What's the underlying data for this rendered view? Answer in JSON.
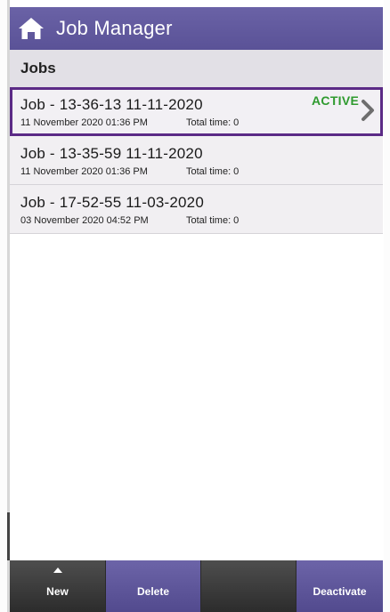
{
  "header": {
    "title": "Job Manager",
    "home_icon": "home-icon",
    "color": "#5f579d"
  },
  "section": {
    "title": "Jobs"
  },
  "jobs": [
    {
      "name": "Job - 13-36-13 11-11-2020",
      "date": "11 November 2020 01:36 PM",
      "total": "Total time: 0",
      "status": "ACTIVE",
      "selected": true
    },
    {
      "name": "Job - 13-35-59 11-11-2020",
      "date": "11 November 2020 01:36 PM",
      "total": "Total time: 0",
      "status": "",
      "selected": false
    },
    {
      "name": "Job - 17-52-55 11-03-2020",
      "date": "03 November 2020 04:52 PM",
      "total": "Total time: 0",
      "status": "",
      "selected": false
    }
  ],
  "toolbar": {
    "new_label": "New",
    "delete_label": "Delete",
    "empty_label": "",
    "deactivate_label": "Deactivate"
  },
  "colors": {
    "accent": "#5f579d",
    "selected_border": "#5b2a86",
    "active_status": "#2e9a2e"
  }
}
